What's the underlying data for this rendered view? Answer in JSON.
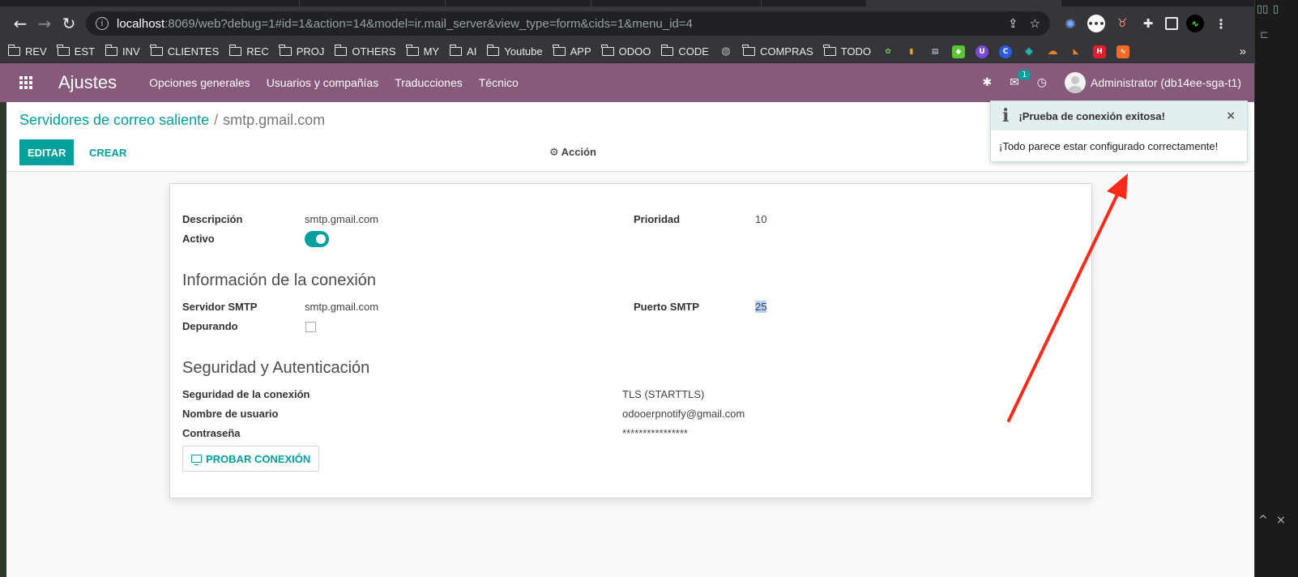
{
  "browser": {
    "url_host": "localhost",
    "url_rest": ":8069/web?debug=1#id=1&action=14&model=ir.mail_server&view_type=form&cids=1&menu_id=4",
    "bookmarks": [
      "REV",
      "EST",
      "INV",
      "CLIENTES",
      "REC",
      "PROJ",
      "OTHERS",
      "MY",
      "AI",
      "Youtube",
      "APP",
      "ODOO",
      "CODE",
      "COMPRAS",
      "TODO"
    ],
    "bookmarks_more": "»"
  },
  "navbar": {
    "app_title": "Ajustes",
    "menu": [
      "Opciones generales",
      "Usuarios y compañías",
      "Traducciones",
      "Técnico"
    ],
    "messages_count": "1",
    "user": "Administrator (db14ee-sga-t1)"
  },
  "control_panel": {
    "breadcrumb_parent": "Servidores de correo saliente",
    "breadcrumb_sep": "/",
    "breadcrumb_current": "smtp.gmail.com",
    "edit_label": "EDITAR",
    "create_label": "CREAR",
    "action_label": "Acción"
  },
  "form": {
    "description_label": "Descripción",
    "description_value": "smtp.gmail.com",
    "active_label": "Activo",
    "active": true,
    "priority_label": "Prioridad",
    "priority_value": "10",
    "connection_title": "Información de la conexión",
    "smtp_server_label": "Servidor SMTP",
    "smtp_server_value": "smtp.gmail.com",
    "debugging_label": "Depurando",
    "debugging": false,
    "smtp_port_label": "Puerto SMTP",
    "smtp_port_value": "25",
    "security_title": "Seguridad y Autenticación",
    "conn_security_label": "Seguridad de la conexión",
    "conn_security_value": "TLS (STARTTLS)",
    "username_label": "Nombre de usuario",
    "username_value": "odooerpnotify@gmail.com",
    "password_label": "Contraseña",
    "password_value": "****************",
    "test_button_label": "PROBAR CONEXIÓN"
  },
  "notification": {
    "title": "¡Prueba de conexión exitosa!",
    "message": "¡Todo parece estar configurado correctamente!",
    "close": "×"
  },
  "colors": {
    "navbar": "#875a7b",
    "primary": "#00a09d",
    "annotation_arrow": "#ff2a1a"
  }
}
